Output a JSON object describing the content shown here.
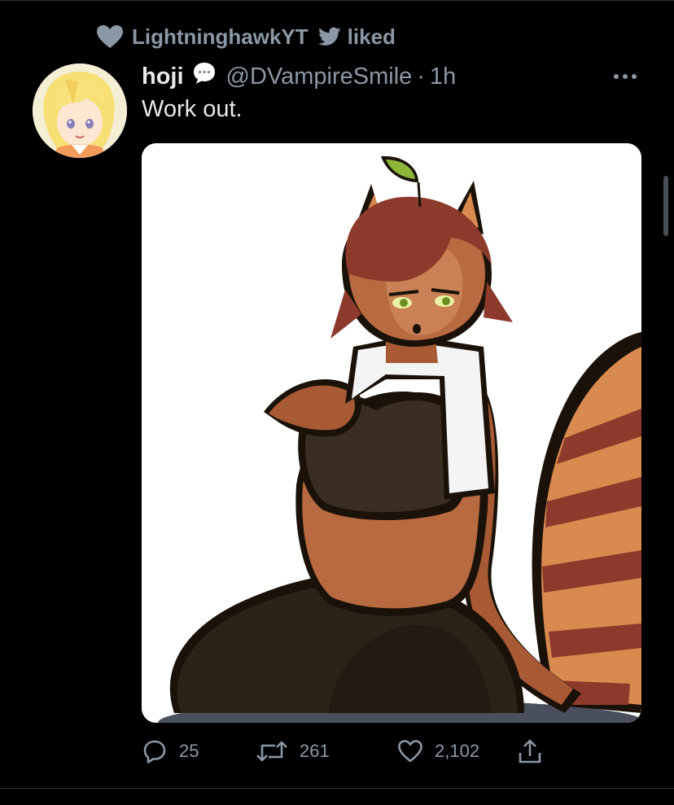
{
  "social_context": {
    "user": "LightninghawkYT",
    "action": "liked",
    "heart_icon": "heart-filled-icon",
    "bird_icon": "twitter-bird-icon"
  },
  "tweet": {
    "display_name": "hoji",
    "badge_icon": "speech-bubble-icon",
    "handle": "@DVampireSmile",
    "separator": "·",
    "time": "1h",
    "text": "Work out."
  },
  "actions": {
    "replies": "25",
    "retweets": "261",
    "likes": "2,102"
  },
  "colors": {
    "background": "#000000",
    "primary_text": "#e7e9ea",
    "secondary_text": "#8b98a5",
    "divider": "#2f3336"
  }
}
